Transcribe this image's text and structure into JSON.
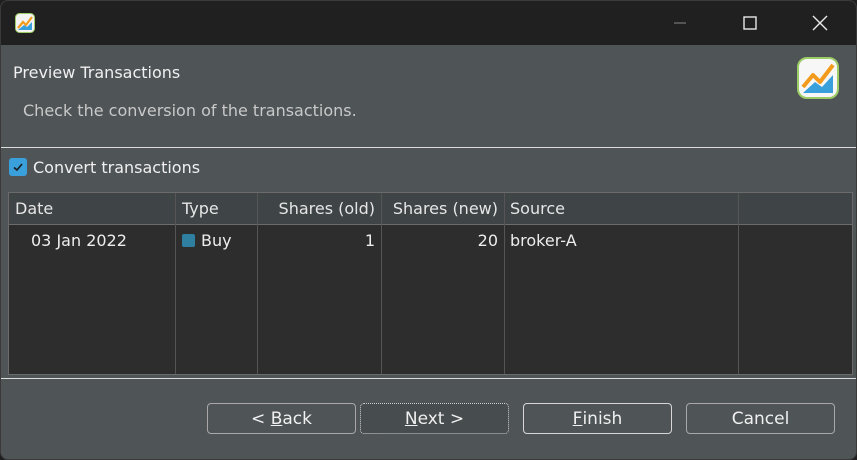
{
  "header": {
    "title": "Preview Transactions",
    "description": "Check the conversion of the transactions."
  },
  "convert": {
    "label": "Convert transactions",
    "checked": true
  },
  "table": {
    "columns": [
      "Date",
      "Type",
      "Shares (old)",
      "Shares (new)",
      "Source"
    ],
    "rows": [
      {
        "date": "03 Jan 2022",
        "type": "Buy",
        "shares_old": "1",
        "shares_new": "20",
        "source": "broker-A"
      }
    ]
  },
  "buttons": {
    "back_pre": "< ",
    "back_mn": "B",
    "back_post": "ack",
    "next_mn": "N",
    "next_post": "ext >",
    "finish_mn": "F",
    "finish_post": "inish",
    "cancel": "Cancel"
  },
  "icons": {
    "app": "app-chart-icon",
    "minimize": "minimize-icon",
    "maximize": "maximize-icon",
    "close": "close-icon",
    "checkbox": "checkmark-icon",
    "type": "buy-type-icon"
  },
  "colors": {
    "accent": "#3aa0dc",
    "titlebar": "#202020",
    "panel": "#4f5457",
    "table_bg": "#2d2d2d"
  }
}
